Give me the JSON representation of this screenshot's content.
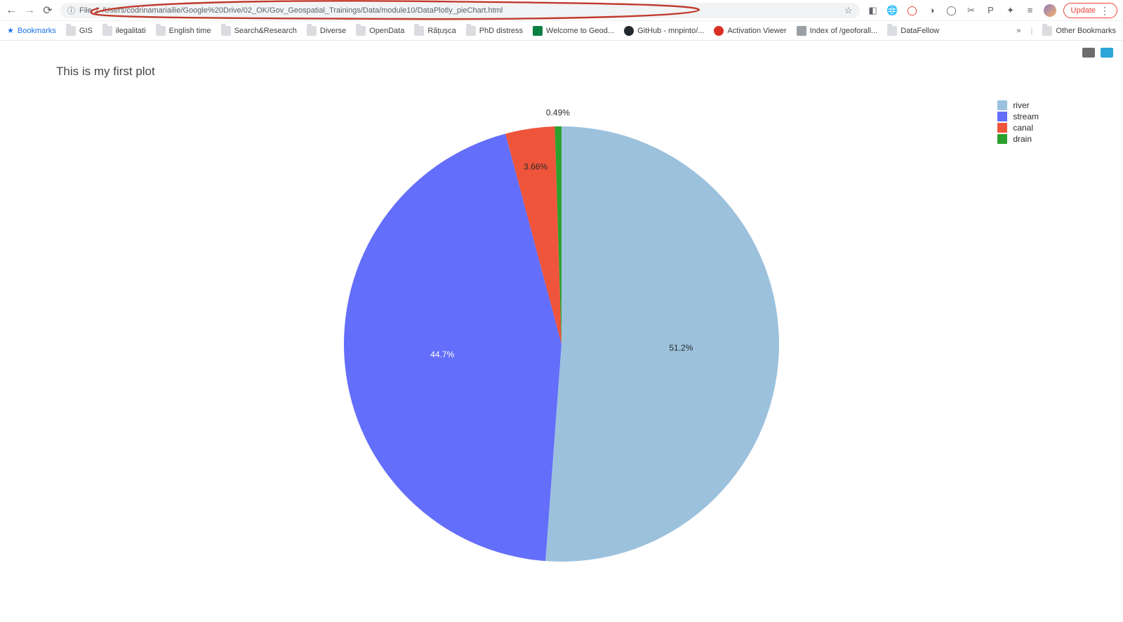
{
  "browser": {
    "url_prefix": "File",
    "url_path": "/Users/codrinamariailie/Google%20Drive/02_OK/Gov_Geospatial_Trainings/Data/module10/DataPlotly_pieChart.html",
    "update_label": "Update"
  },
  "bookmarks": {
    "items": [
      {
        "label": "Bookmarks",
        "type": "star"
      },
      {
        "label": "GIS",
        "type": "folder"
      },
      {
        "label": "ilegalitati",
        "type": "folder"
      },
      {
        "label": "English time",
        "type": "folder"
      },
      {
        "label": "Search&Research",
        "type": "folder"
      },
      {
        "label": "Diverse",
        "type": "folder"
      },
      {
        "label": "OpenData",
        "type": "folder"
      },
      {
        "label": "Rățușca",
        "type": "folder"
      },
      {
        "label": "PhD distress",
        "type": "folder"
      },
      {
        "label": "Welcome to Geod...",
        "type": "green"
      },
      {
        "label": "GitHub - mnpinto/...",
        "type": "gh"
      },
      {
        "label": "Activation Viewer",
        "type": "red"
      },
      {
        "label": "Index of /geoforall...",
        "type": "grey"
      },
      {
        "label": "DataFellow",
        "type": "folder"
      }
    ],
    "overflow": "»",
    "other": "Other Bookmarks"
  },
  "chart_data": {
    "type": "pie",
    "title": "This is my first plot",
    "series": [
      {
        "name": "river",
        "value": 51.2,
        "color": "#9cc1dd",
        "label": "51.2%"
      },
      {
        "name": "stream",
        "value": 44.7,
        "color": "#636efa",
        "label": "44.7%"
      },
      {
        "name": "canal",
        "value": 3.66,
        "color": "#ef553b",
        "label": "3.66%"
      },
      {
        "name": "drain",
        "value": 0.49,
        "color": "#2ca02c",
        "label": "0.49%"
      }
    ]
  }
}
